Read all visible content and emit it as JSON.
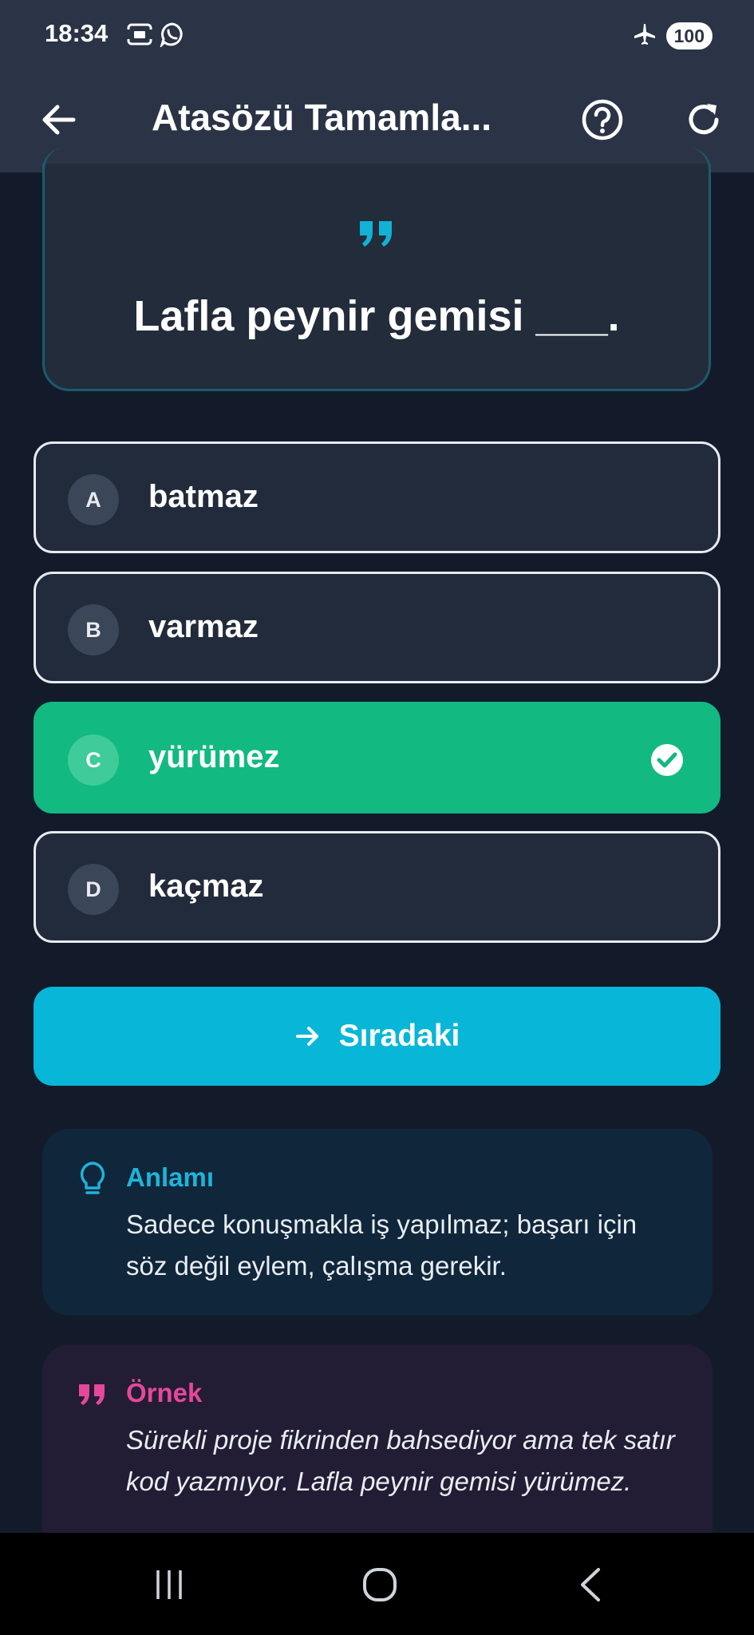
{
  "status_bar": {
    "time": "18:34",
    "left_icons": [
      "gallery-icon",
      "whatsapp-icon"
    ],
    "right_icons": [
      "airplane-icon"
    ],
    "battery": "100"
  },
  "app_bar": {
    "title": "Atasözü Tamamla...",
    "back_icon": "arrow-left-icon",
    "help_icon": "help-circle-icon",
    "refresh_icon": "refresh-icon"
  },
  "question": {
    "quote_icon": "quote-icon",
    "text": "Lafla peynir gemisi ___."
  },
  "options": [
    {
      "letter": "A",
      "label": "batmaz",
      "state": "default"
    },
    {
      "letter": "B",
      "label": "varmaz",
      "state": "default"
    },
    {
      "letter": "C",
      "label": "yürümez",
      "state": "correct"
    },
    {
      "letter": "D",
      "label": "kaçmaz",
      "state": "default"
    }
  ],
  "next_button": {
    "label": "Sıradaki",
    "icon": "arrow-right-icon"
  },
  "meaning": {
    "title": "Anlamı",
    "body": "Sadece konuşmakla iş yapılmaz; başarı için söz değil eylem, çalışma gerekir.",
    "icon": "lightbulb-icon"
  },
  "example": {
    "title": "Örnek",
    "body": "Sürekli proje fikrinden bahsediyor ama tek satır kod yazmıyor. Lafla peynir gemisi yürümez.",
    "icon": "quote-icon"
  },
  "nav_bar": {
    "icons": [
      "recents-icon",
      "home-icon",
      "back-icon"
    ]
  },
  "colors": {
    "background": "#131b2b",
    "app_bar": "#2b3446",
    "correct": "#12b981",
    "accent": "#08b6d8",
    "example_accent": "#e5489b"
  }
}
